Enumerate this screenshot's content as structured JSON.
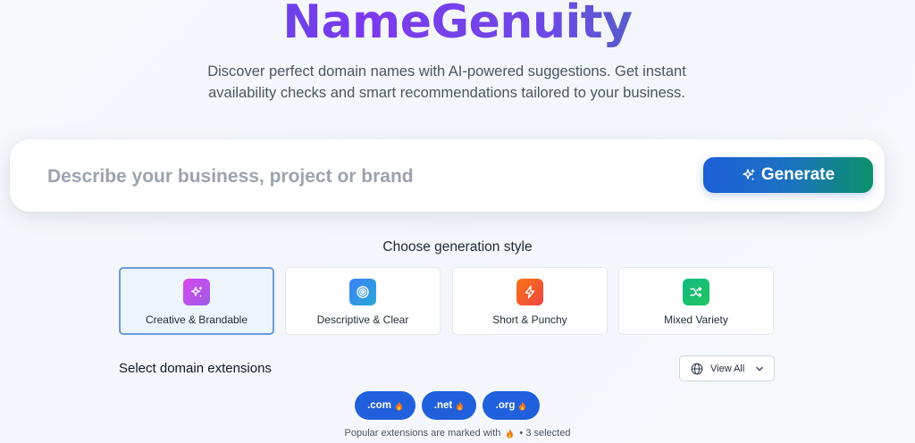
{
  "header": {
    "logo_text": "NameGenuity",
    "tagline": "Discover perfect domain names with AI-powered suggestions. Get instant availability checks and smart recommendations tailored to your business."
  },
  "search": {
    "placeholder": "Describe your business, project or brand",
    "value": "",
    "generate_label": "Generate",
    "generate_icon": "sparkles-icon"
  },
  "styles": {
    "title": "Choose generation style",
    "items": [
      {
        "label": "Creative & Brandable",
        "icon": "sparkles-icon",
        "color": "#c054d8",
        "selected": true
      },
      {
        "label": "Descriptive & Clear",
        "icon": "target-icon",
        "color": "#3b82f6",
        "selected": false
      },
      {
        "label": "Short & Punchy",
        "icon": "lightning-icon",
        "color": "#f05a28",
        "selected": false
      },
      {
        "label": "Mixed Variety",
        "icon": "shuffle-icon",
        "color": "#10b981",
        "selected": false
      }
    ]
  },
  "extensions": {
    "title": "Select domain extensions",
    "view_all_label": "View All",
    "chips": [
      {
        "label": ".com",
        "popular": true
      },
      {
        "label": ".net",
        "popular": true
      },
      {
        "label": ".org",
        "popular": true
      }
    ],
    "note_prefix": "Popular extensions are marked with",
    "note_suffix": "• 3 selected"
  },
  "colors": {
    "accent_blue": "#2160dc",
    "accent_green": "#0b9168",
    "selected_border": "#6b9bd6"
  }
}
